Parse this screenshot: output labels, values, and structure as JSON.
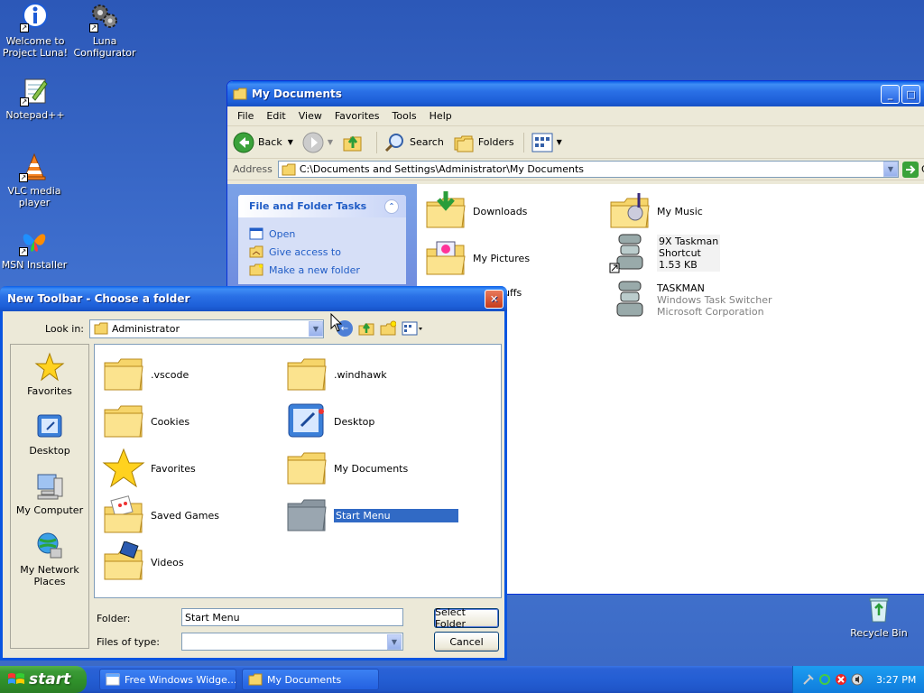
{
  "desktop": {
    "icons": [
      {
        "label_line1": "Welcome to",
        "label_line2": "Project Luna!",
        "icon": "info-icon"
      },
      {
        "label_line1": "Luna",
        "label_line2": "Configurator",
        "icon": "gears-icon"
      },
      {
        "label_line1": "Notepad++",
        "label_line2": "",
        "icon": "notepad-icon"
      },
      {
        "label_line1": "VLC media",
        "label_line2": "player",
        "icon": "vlc-cone-icon"
      },
      {
        "label_line1": "MSN Installer",
        "label_line2": "",
        "icon": "msn-butterfly-icon"
      },
      {
        "label_line1": "Recycle Bin",
        "label_line2": "",
        "icon": "recycle-bin-icon"
      }
    ]
  },
  "explorer": {
    "title": "My Documents",
    "menu": [
      "File",
      "Edit",
      "View",
      "Favorites",
      "Tools",
      "Help"
    ],
    "toolbar": {
      "back": "Back",
      "search": "Search",
      "folders": "Folders"
    },
    "address_label": "Address",
    "address_value": "C:\\Documents and Settings\\Administrator\\My Documents",
    "go_label": "G",
    "tasks": {
      "header": "File and Folder Tasks",
      "items": [
        "Open",
        "Give access to",
        "Make a new folder"
      ]
    },
    "files": [
      {
        "name": "Downloads"
      },
      {
        "name": "My Music"
      },
      {
        "name": "My Pictures"
      },
      {
        "name": "9X Taskman",
        "line2": "Shortcut",
        "line3": "1.53 KB"
      },
      {
        "name": "uffs"
      },
      {
        "name": "TASKMAN",
        "line2": "Windows Task Switcher",
        "line3": "Microsoft Corporation"
      }
    ]
  },
  "dialog": {
    "title": "New Toolbar - Choose a folder",
    "look_in_label": "Look in:",
    "look_in_value": "Administrator",
    "places": [
      "Favorites",
      "Desktop",
      "My Computer",
      "My Network",
      "Places"
    ],
    "items": [
      {
        "name": ".vscode"
      },
      {
        "name": ".windhawk"
      },
      {
        "name": "Cookies"
      },
      {
        "name": "Desktop"
      },
      {
        "name": "Favorites"
      },
      {
        "name": "My Documents"
      },
      {
        "name": "Saved Games"
      },
      {
        "name": "Start Menu"
      },
      {
        "name": "Videos"
      }
    ],
    "folder_label": "Folder:",
    "folder_value": "Start Menu",
    "type_label": "Files of type:",
    "type_value": "",
    "select_button": "Select Folder",
    "cancel_button": "Cancel"
  },
  "taskbar": {
    "start_label": "start",
    "tasks": [
      "Free Windows Widge...",
      "My Documents"
    ],
    "clock": "3:27 PM"
  }
}
